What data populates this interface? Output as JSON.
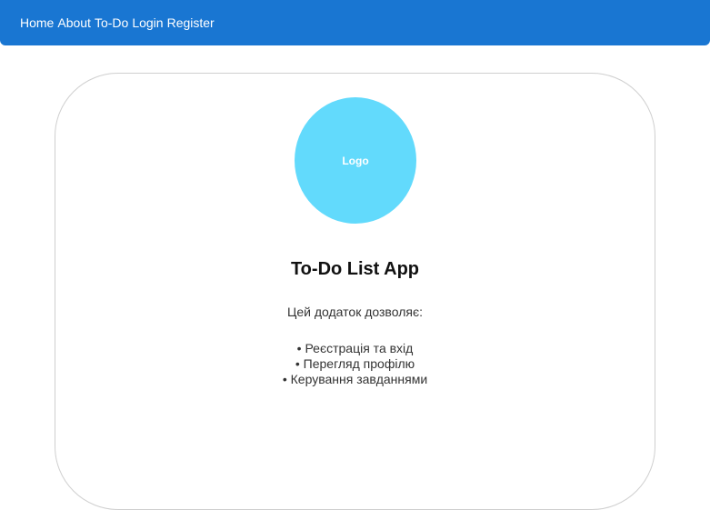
{
  "nav": {
    "links": [
      "Home",
      "About",
      "To-Do",
      "Login",
      "Register"
    ]
  },
  "card": {
    "logo_text": "Logo",
    "title": "To-Do List App",
    "intro": "Цей додаток дозволяє:",
    "features": [
      "• Реєстрація та вхід",
      "• Перегляд профілю",
      "• Керування завданнями"
    ]
  },
  "colors": {
    "nav_bg": "#1976d2",
    "logo_bg": "#62dafc"
  }
}
